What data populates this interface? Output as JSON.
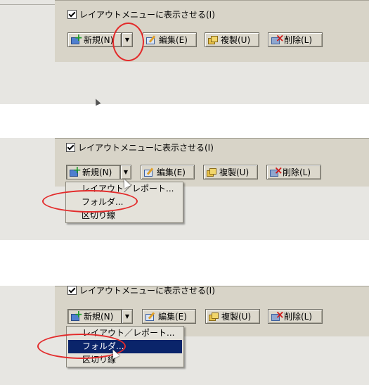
{
  "options": {
    "show_in_layout_menu": "レイアウトメニューに表示させる(I)",
    "checked": true
  },
  "toolbar": {
    "new_label": "新規(N)",
    "edit_label": "編集(E)",
    "copy_label": "複製(U)",
    "delete_label": "削除(L)",
    "dropdown_arrow": "▼"
  },
  "new_menu": {
    "items": [
      "レイアウト／レポート...",
      "フォルダ...",
      "区切り線"
    ]
  },
  "icons": {
    "new": "new-icon",
    "edit": "edit-icon",
    "copy": "copy-icon",
    "delete": "delete-icon"
  },
  "colors": {
    "annotation_circle": "#e32b2b",
    "selection": "#0a246a",
    "panel": "#d8d4c8"
  }
}
